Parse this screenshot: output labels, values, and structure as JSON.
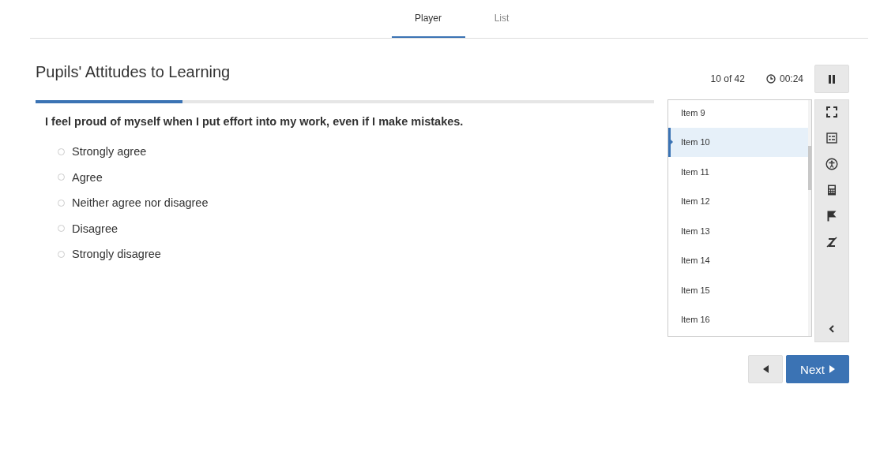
{
  "tabs": [
    {
      "label": "Player",
      "selected": true
    },
    {
      "label": "List",
      "selected": false
    }
  ],
  "title": "Pupils' Attitudes to Learning",
  "progress": {
    "level": 0.238
  },
  "counter": "10 of 42",
  "timer": "00:24",
  "question": "I feel proud of myself when I put effort into my work, even if I make mistakes.",
  "options": [
    {
      "label": "Strongly agree",
      "selected": false
    },
    {
      "label": "Agree",
      "selected": false
    },
    {
      "label": "Neither agree nor disagree",
      "selected": false
    },
    {
      "label": "Disagree",
      "selected": false
    },
    {
      "label": "Strongly disagree",
      "selected": false
    }
  ],
  "items": [
    {
      "label": "Item 9",
      "selected": false
    },
    {
      "label": "Item 10",
      "selected": true
    },
    {
      "label": "Item 11",
      "selected": false
    },
    {
      "label": "Item 12",
      "selected": false
    },
    {
      "label": "Item 13",
      "selected": false
    },
    {
      "label": "Item 14",
      "selected": false
    },
    {
      "label": "Item 15",
      "selected": false
    },
    {
      "label": "Item 16",
      "selected": false
    }
  ],
  "next_button": "Next"
}
